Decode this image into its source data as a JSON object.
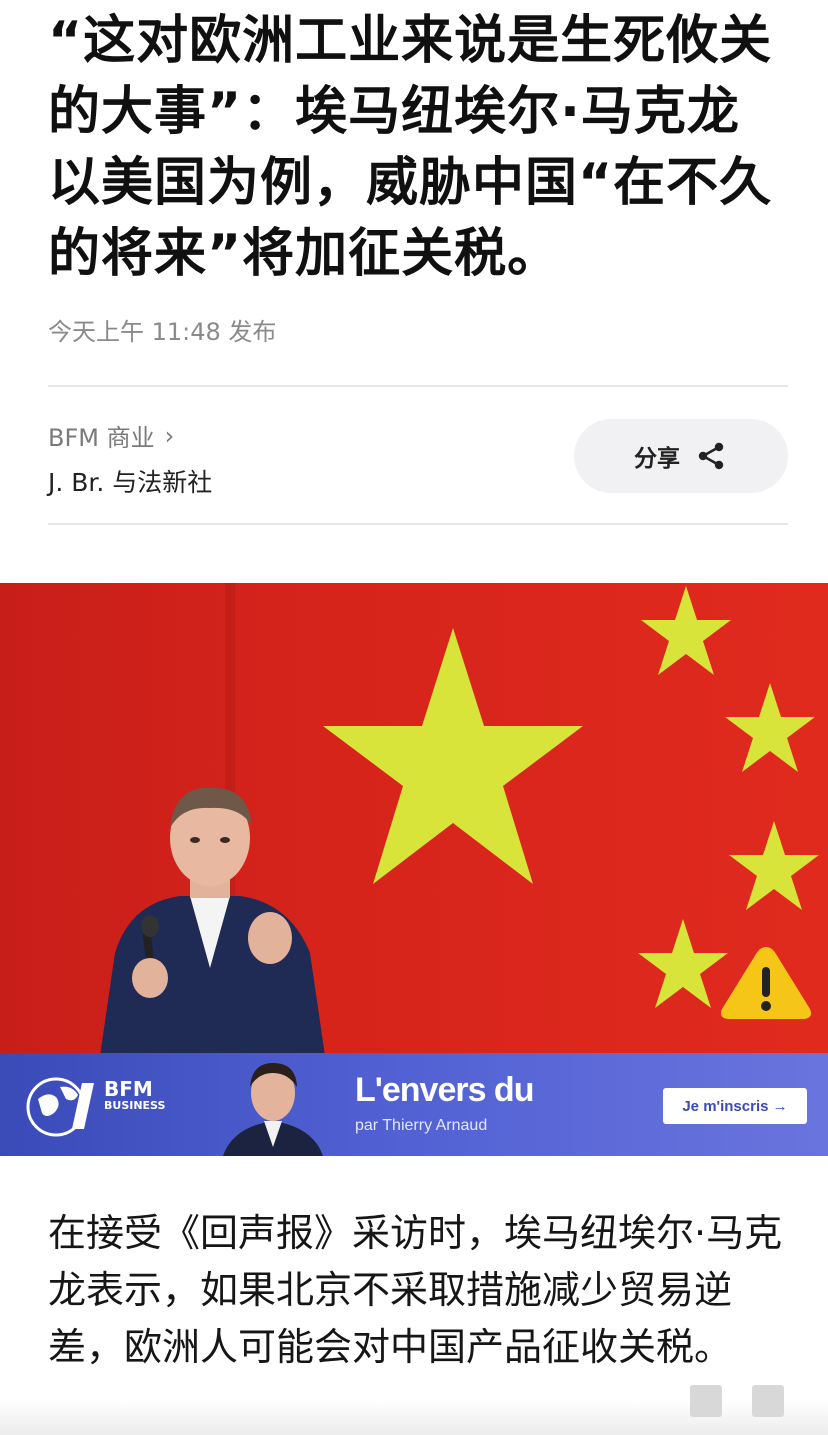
{
  "article": {
    "headline": "“这对欧洲工业来说是生死攸关的大事”：埃马纽埃尔·马克龙以美国为例，威胁中国“在不久的将来”将加征关税。",
    "published": "今天上午 11:48 发布",
    "source": "BFM 商业",
    "source_chevron": "›",
    "author": "J. Br. 与法新社",
    "share_label": "分享",
    "body": "在接受《回声报》采访时，埃马纽埃尔·马克龙表示，如果北京不采取措施减少贸易逆差，欧洲人可能会对中国产品征收关税。"
  },
  "hero": {
    "flag_red": "#d6241b",
    "star_color": "#d9e43a",
    "warning_icon": "warning-triangle-icon",
    "warning_color": "#f5c518"
  },
  "ad": {
    "brand": "BFM",
    "brand_sub": "BUSINESS",
    "title": "L'envers du",
    "byline": "par Thierry Arnaud",
    "cta": "Je m'inscris →",
    "bg_color": "#4a5ac8"
  }
}
